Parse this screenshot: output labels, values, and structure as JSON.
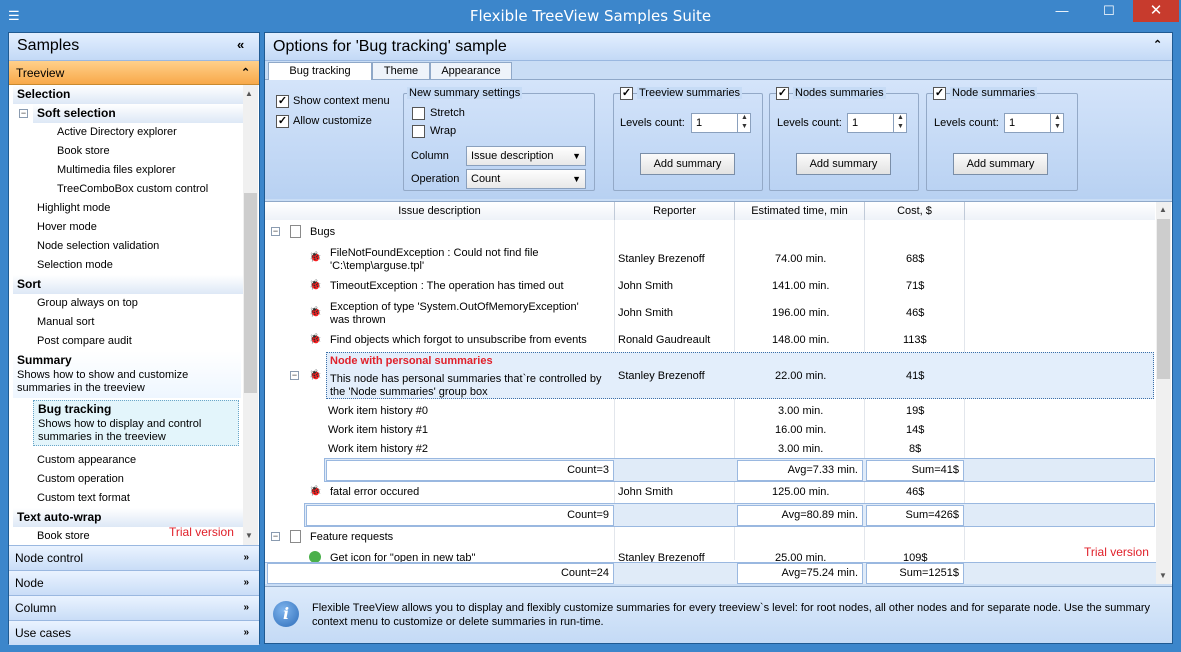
{
  "window": {
    "title": "Flexible TreeView Samples Suite",
    "minimize": "—",
    "maximize": "☐",
    "close": "✕"
  },
  "sidebar": {
    "title": "Samples",
    "collapse": "«",
    "treeview_group": {
      "label": "Treeview",
      "chev": "⌃"
    },
    "sections": {
      "selection": "Selection",
      "soft_selection": "Soft selection",
      "soft_items": [
        "Active Directory explorer",
        "Book store",
        "Multimedia files explorer",
        "TreeComboBox custom control"
      ],
      "selection_items": [
        "Highlight mode",
        "Hover mode",
        "Node selection validation",
        "Selection mode"
      ],
      "sort": "Sort",
      "sort_items": [
        "Group always on top",
        "Manual sort",
        "Post compare audit"
      ],
      "summary": "Summary",
      "summary_desc": "Shows how to show and customize summaries in the treeview",
      "bug_tracking": "Bug tracking",
      "bug_tracking_desc": "Shows how to display and control summaries in the treeview",
      "summary_items": [
        "Custom appearance",
        "Custom operation",
        "Custom text format"
      ],
      "text_autowrap": "Text auto-wrap",
      "autowrap_items": [
        "Book store"
      ]
    },
    "trial": "Trial version",
    "groups": [
      {
        "label": "Node control",
        "chev": "»"
      },
      {
        "label": "Node",
        "chev": "»"
      },
      {
        "label": "Column",
        "chev": "»"
      },
      {
        "label": "Use cases",
        "chev": "»"
      }
    ]
  },
  "main": {
    "title": "Options for 'Bug tracking' sample",
    "collapse": "«",
    "tabs": [
      "Bug tracking",
      "Theme",
      "Appearance"
    ],
    "options": {
      "show_context_menu": "Show context menu",
      "allow_customize": "Allow customize",
      "new_summary": {
        "title": "New summary settings",
        "stretch": "Stretch",
        "wrap": "Wrap",
        "column_label": "Column",
        "column_value": "Issue description",
        "operation_label": "Operation",
        "operation_value": "Count"
      },
      "groups": [
        {
          "title": "Treeview summaries",
          "levels_label": "Levels count:",
          "levels_value": "1",
          "button": "Add summary"
        },
        {
          "title": "Nodes summaries",
          "levels_label": "Levels count:",
          "levels_value": "1",
          "button": "Add summary"
        },
        {
          "title": "Node summaries",
          "levels_label": "Levels count:",
          "levels_value": "1",
          "button": "Add summary"
        }
      ],
      "check_mark": "✓"
    },
    "columns": [
      "Issue description",
      "Reporter",
      "Estimated time, min",
      "Cost, $"
    ],
    "tree": {
      "bugs": "Bugs",
      "rows": [
        {
          "desc": "FileNotFoundException : Could not find file 'C:\\temp\\arguse.tpl'",
          "reporter": "Stanley Brezenoff",
          "time": "74.00 min.",
          "cost": "68$"
        },
        {
          "desc": "TimeoutException : The operation has timed out",
          "reporter": "John Smith",
          "time": "141.00 min.",
          "cost": "71$"
        },
        {
          "desc": "Exception of type 'System.OutOfMemoryException' was thrown",
          "reporter": "John Smith",
          "time": "196.00 min.",
          "cost": "46$"
        },
        {
          "desc": "Find objects which forgot to unsubscribe from events",
          "reporter": "Ronald Gaudreault",
          "time": "148.00 min.",
          "cost": "113$"
        }
      ],
      "personal": {
        "title": "Node with personal summaries",
        "desc": "This node has personal summaries that`re controlled by the 'Node summaries' group box",
        "reporter": "Stanley Brezenoff",
        "time": "22.00 min.",
        "cost": "41$"
      },
      "history": [
        {
          "desc": "Work item history #0",
          "time": "3.00 min.",
          "cost": "19$"
        },
        {
          "desc": "Work item history #1",
          "time": "16.00 min.",
          "cost": "14$"
        },
        {
          "desc": "Work item history #2",
          "time": "3.00 min.",
          "cost": "8$"
        }
      ],
      "node_sum": {
        "count": "Count=3",
        "avg": "Avg=7.33 min.",
        "sum": "Sum=41$"
      },
      "fatal": {
        "desc": "fatal error occured",
        "reporter": "John Smith",
        "time": "125.00 min.",
        "cost": "46$"
      },
      "bugs_sum": {
        "count": "Count=9",
        "avg": "Avg=80.89 min.",
        "sum": "Sum=426$"
      },
      "features": "Feature requests",
      "feature_row": {
        "desc": "Get icon for \"open in new tab\"",
        "reporter": "Stanley Brezenoff",
        "time": "25.00 min.",
        "cost": "109$"
      },
      "total_sum": {
        "count": "Count=24",
        "avg": "Avg=75.24 min.",
        "sum": "Sum=1251$"
      },
      "trial": "Trial version"
    },
    "info": "Flexible TreeView allows you to display and flexibly customize summaries for every treeview`s level: for root nodes, all other nodes and for separate node. Use the summary context menu to customize or delete summaries in run-time.",
    "info_icon": "i"
  },
  "colors": {
    "accent": "#3c86cb",
    "trial": "#e0202a",
    "selected": "#e3eefb"
  }
}
